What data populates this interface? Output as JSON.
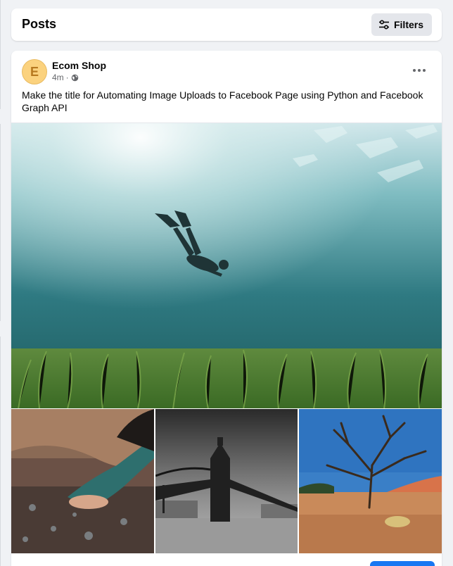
{
  "header": {
    "title": "Posts",
    "filters_label": "Filters",
    "filters_icon": "sliders-icon"
  },
  "post": {
    "avatar_letter": "E",
    "author": "Ecom Shop",
    "time": "4m",
    "separator": "·",
    "privacy_icon": "globe-icon",
    "more_icon": "more-horizontal-icon",
    "text": "Make the title for Automating Image Uploads to Facebook Page using Python and Facebook Graph API",
    "images": [
      {
        "name": "freediver-underwater-photo"
      },
      {
        "name": "hands-holding-stones-photo"
      },
      {
        "name": "tower-bridge-bw-photo"
      },
      {
        "name": "desert-dead-tree-photo"
      }
    ]
  },
  "colors": {
    "accent": "#1877f2",
    "avatar_bg": "#fbd27e",
    "page_bg": "#f0f2f5"
  }
}
